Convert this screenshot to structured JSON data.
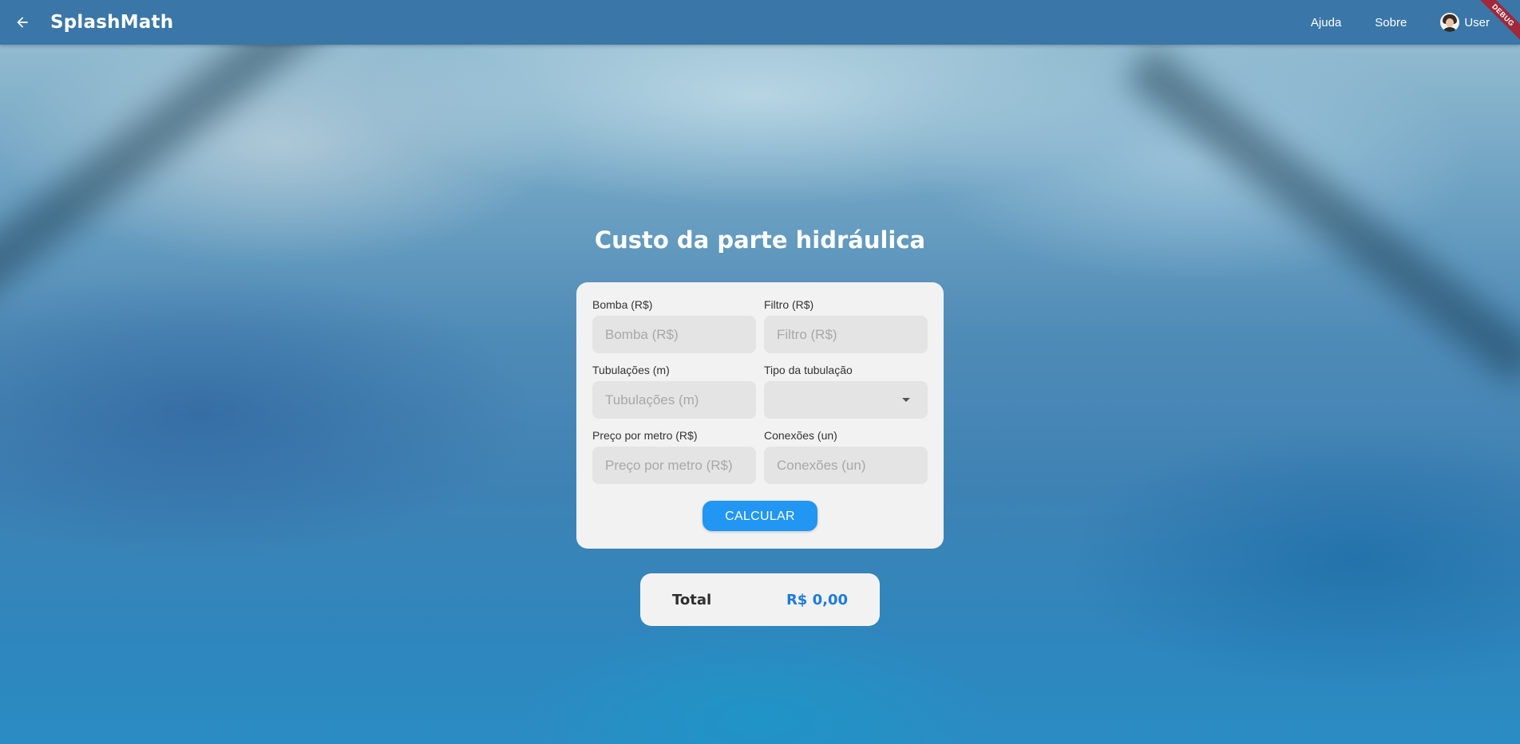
{
  "app": {
    "title": "SplashMath",
    "debug_banner": "DEBUG"
  },
  "nav": {
    "help": "Ajuda",
    "about": "Sobre",
    "user": "User"
  },
  "page": {
    "title": "Custo da parte hidráulica"
  },
  "form": {
    "pump": {
      "label": "Bomba (R$)",
      "placeholder": "Bomba (R$)",
      "value": ""
    },
    "filter": {
      "label": "Filtro (R$)",
      "placeholder": "Filtro (R$)",
      "value": ""
    },
    "pipes": {
      "label": "Tubulações (m)",
      "placeholder": "Tubulações (m)",
      "value": ""
    },
    "pipe_type": {
      "label": "Tipo da tubulação",
      "selected": ""
    },
    "price_per_meter": {
      "label": "Preço por metro (R$)",
      "placeholder": "Preço por metro (R$)",
      "value": ""
    },
    "connections": {
      "label": "Conexões (un)",
      "placeholder": "Conexões (un)",
      "value": ""
    },
    "calculate_label": "CALCULAR"
  },
  "total": {
    "label": "Total",
    "value": "R$ 0,00"
  },
  "colors": {
    "appbar": "#3a76a8",
    "primary_button": "#2196f3",
    "total_value": "#1e7be0",
    "card": "#f2f2f2"
  }
}
